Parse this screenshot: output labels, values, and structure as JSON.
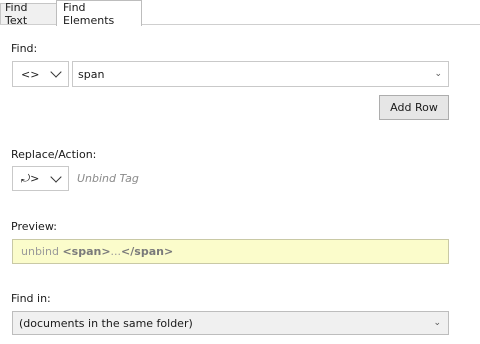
{
  "tabs": [
    {
      "label": "Find Text",
      "active": false
    },
    {
      "label": "Find Elements",
      "active": true
    }
  ],
  "find": {
    "label": "Find:",
    "mode_icon": "angle-brackets-icon",
    "value": "span",
    "add_row_label": "Add Row"
  },
  "replace": {
    "label": "Replace/Action:",
    "action_icon": "unbind-tag-icon",
    "action_text": "Unbind Tag"
  },
  "preview": {
    "label": "Preview:",
    "prefix": "unbind ",
    "open_tag": "<span>",
    "middle": "...",
    "close_tag": "</span>"
  },
  "find_in": {
    "label": "Find in:",
    "value": "(documents in the same folder)"
  },
  "colors": {
    "preview_bg": "#fbfccb",
    "button_bg": "#e6e6e6"
  }
}
